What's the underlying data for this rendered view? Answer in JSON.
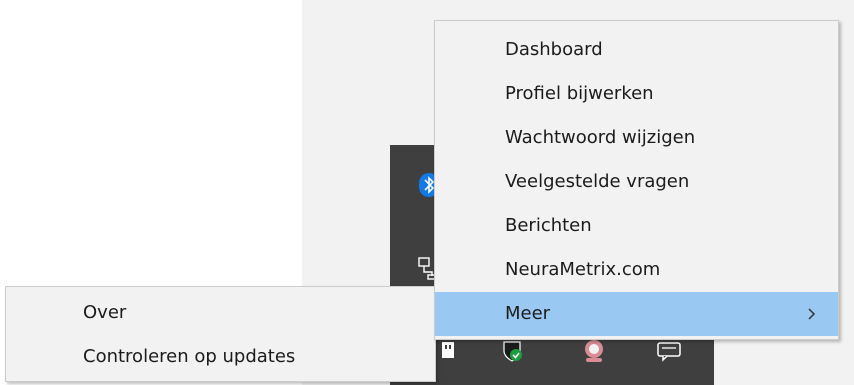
{
  "main_menu": {
    "items": [
      {
        "label": "Dashboard"
      },
      {
        "label": "Profiel bijwerken"
      },
      {
        "label": "Wachtwoord wijzigen"
      },
      {
        "label": "Veelgestelde vragen"
      },
      {
        "label": "Berichten"
      },
      {
        "label": "NeuraMetrix.com"
      },
      {
        "label": "Meer",
        "has_submenu": true,
        "highlighted": true
      }
    ]
  },
  "submenu": {
    "items": [
      {
        "label": "Over"
      },
      {
        "label": "Controleren op updates"
      }
    ]
  },
  "tray_icons": [
    "bluetooth-icon",
    "network-icon",
    "usb-icon",
    "windows-defender-icon",
    "app-icon",
    "chat-icon"
  ],
  "colors": {
    "menu_background": "#f2f2f2",
    "menu_highlight": "#99c9f3",
    "tray_background": "#3f3f3f",
    "text": "#1b1b1b"
  }
}
